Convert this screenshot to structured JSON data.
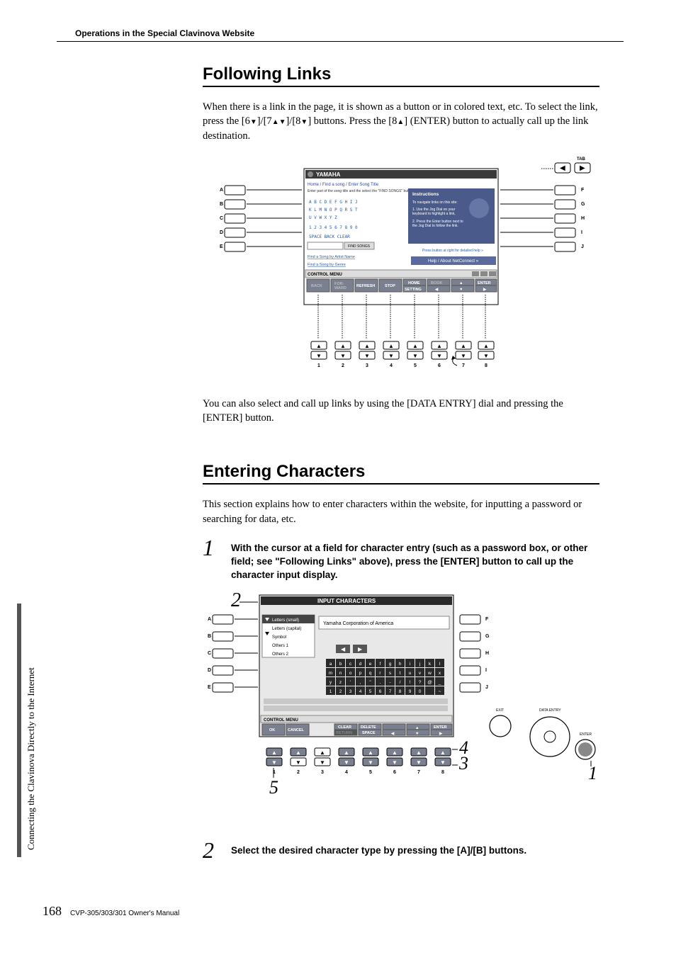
{
  "header": "Operations in the Special Clavinova Website",
  "section1": {
    "title": "Following Links",
    "para1_a": "When there is a link in the page, it is shown as a button or in colored text, etc. To select the link, press the [6",
    "para1_b": "]/[7",
    "para1_c": "]/[8",
    "para1_d": "] buttons. Press the [8",
    "para1_e": "] (ENTER) button to actually call up the link destination.",
    "para2": "You can also select and call up links by using the [DATA ENTRY] dial and pressing the [ENTER] button."
  },
  "section2": {
    "title": "Entering Characters",
    "para1": "This section explains how to enter characters within the website, for inputting a password or searching for data, etc.",
    "step1_num": "1",
    "step1_text": "With the cursor at a field for character entry (such as a password box, or other field; see \"Following Links\" above), press the [ENTER] button to call up the character input display.",
    "step2_num": "2",
    "step2_text": "Select the desired character type by pressing the [A]/[B] buttons."
  },
  "figure1": {
    "tab_label": "TAB",
    "yamaha": "YAMAHA",
    "breadcrumb": "Home / Find a song / Enter Song Title",
    "prompt": "Enter part of the song title and the select the \"FIND SONGS\" button.",
    "alpha1": "A  B  C  D  E  F  G  H  I  J",
    "alpha2": "K  L  M  N  O  P  Q  R  S  T",
    "alpha3": "U  V  W  X  Y  Z",
    "nums": "1  2  3  4  5  6  7  8  9  0",
    "bottom_links": "SPACE   BACK   CLEAR",
    "find_songs": "FIND SONGS",
    "find_by_artist": "Find a Song by Artist Name",
    "find_by_genre": "Find a Song by Genre",
    "instructions_title": "Instructions",
    "instr1": "To navigate links on this site:",
    "instr2": "1. Use the Jog Dial on your keyboard to highlight a link,",
    "instr3": "2. Press the Enter button next to the Jog Dial to follow the highlighted link.",
    "help_link": "Press button at right for detailed help",
    "help_about": "Help / About NetConnect",
    "control_menu": "CONTROL MENU",
    "back": "BACK",
    "forward": "FOR-WARD",
    "refresh": "REFRESH",
    "stop": "STOP",
    "home": "HOME",
    "setting": "SETTING",
    "bookmark": "BOOK MARK",
    "enter": "ENTER",
    "left_labels": [
      "A",
      "B",
      "C",
      "D",
      "E"
    ],
    "right_labels": [
      "F",
      "G",
      "H",
      "I",
      "J"
    ],
    "btn_labels": [
      "1",
      "2",
      "3",
      "4",
      "5",
      "6",
      "7",
      "8"
    ]
  },
  "figure2": {
    "title": "INPUT CHARACTERS",
    "opts": [
      "Letters (small)",
      "Letters (capital)",
      "Symbol",
      "Others 1",
      "Others 2"
    ],
    "sample": "Yamaha Corporation of America",
    "row1": [
      "a",
      "b",
      "c",
      "d",
      "e",
      "f",
      "g",
      "h",
      "i",
      "j",
      "k",
      "l"
    ],
    "row2": [
      "m",
      "n",
      "o",
      "p",
      "q",
      "r",
      "s",
      "t",
      "u",
      "v",
      "w",
      "x"
    ],
    "row3": [
      "y",
      "z",
      "'",
      ",",
      "\"",
      ".",
      "-",
      "/",
      "!",
      "?",
      "@",
      "_"
    ],
    "row4": [
      "1",
      "2",
      "3",
      "4",
      "5",
      "6",
      "7",
      "8",
      "9",
      "0",
      "",
      "~"
    ],
    "control_menu": "CONTROL MENU",
    "ok": "OK",
    "cancel": "CANCEL",
    "clear": "CLEAR",
    "delete": "DELETE",
    "return": "RETURN",
    "space": "SPACE",
    "enter": "ENTER",
    "exit": "EXIT",
    "data_entry": "DATA ENTRY",
    "enter_btn": "ENTER",
    "left_labels": [
      "A",
      "B",
      "C",
      "D",
      "E"
    ],
    "right_labels": [
      "F",
      "G",
      "H",
      "I",
      "J"
    ],
    "btn_labels": [
      "1",
      "2",
      "3",
      "4",
      "5",
      "6",
      "7",
      "8"
    ],
    "callouts": {
      "c1": "1",
      "c2": "2",
      "c3": "3",
      "c4": "4",
      "c5": "5"
    }
  },
  "sidebar": "Connecting the Clavinova Directly to the Internet",
  "footer": {
    "page": "168",
    "manual": "CVP-305/303/301 Owner's Manual"
  }
}
